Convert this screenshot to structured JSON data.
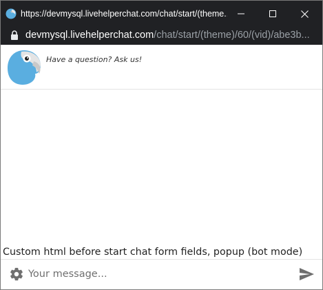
{
  "window": {
    "title": "https://devmysql.livehelperchat.com/chat/start/(theme...",
    "controls": {
      "minimize": "minimize-icon",
      "maximize": "maximize-icon",
      "close": "close-icon"
    }
  },
  "address_bar": {
    "host": "devmysql.livehelperchat.com",
    "path": "/chat/start/(theme)/60/(vid)/abe3b..."
  },
  "chat": {
    "intro_text": "Have a question? Ask us!",
    "custom_html": "Custom html before start chat form fields, popup (bot mode)",
    "composer": {
      "placeholder": "Your message...",
      "value": ""
    }
  },
  "icons": {
    "favicon": "parrot-favicon-icon",
    "lock": "lock-icon",
    "avatar": "parrot-avatar",
    "settings": "gear-icon",
    "send": "send-icon"
  },
  "colors": {
    "titlebar_bg": "#202124",
    "url_path": "#9aa0a6",
    "parrot_blue": "#5aaee0",
    "icon_gray": "#6f6f6f"
  }
}
